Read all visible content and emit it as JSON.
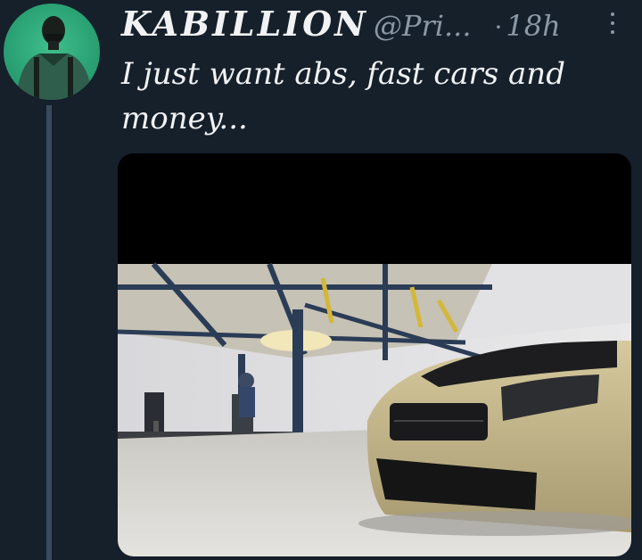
{
  "tweet": {
    "display_name": "KABILLION",
    "handle": "@Pri...",
    "separator": "·",
    "timestamp": "18h",
    "text": "I just want abs, fast cars and money...",
    "more_icon": "more-vertical-icon"
  },
  "avatar": {
    "background_color": "#2aa174"
  },
  "media": {
    "type": "video-frame",
    "scene": "garage-gym",
    "letterbox_color": "#000000"
  },
  "colors": {
    "background": "#15202b",
    "text_primary": "#f0f2f3",
    "text_secondary": "#8b98a5",
    "thread_line": "#3a4a5a"
  }
}
